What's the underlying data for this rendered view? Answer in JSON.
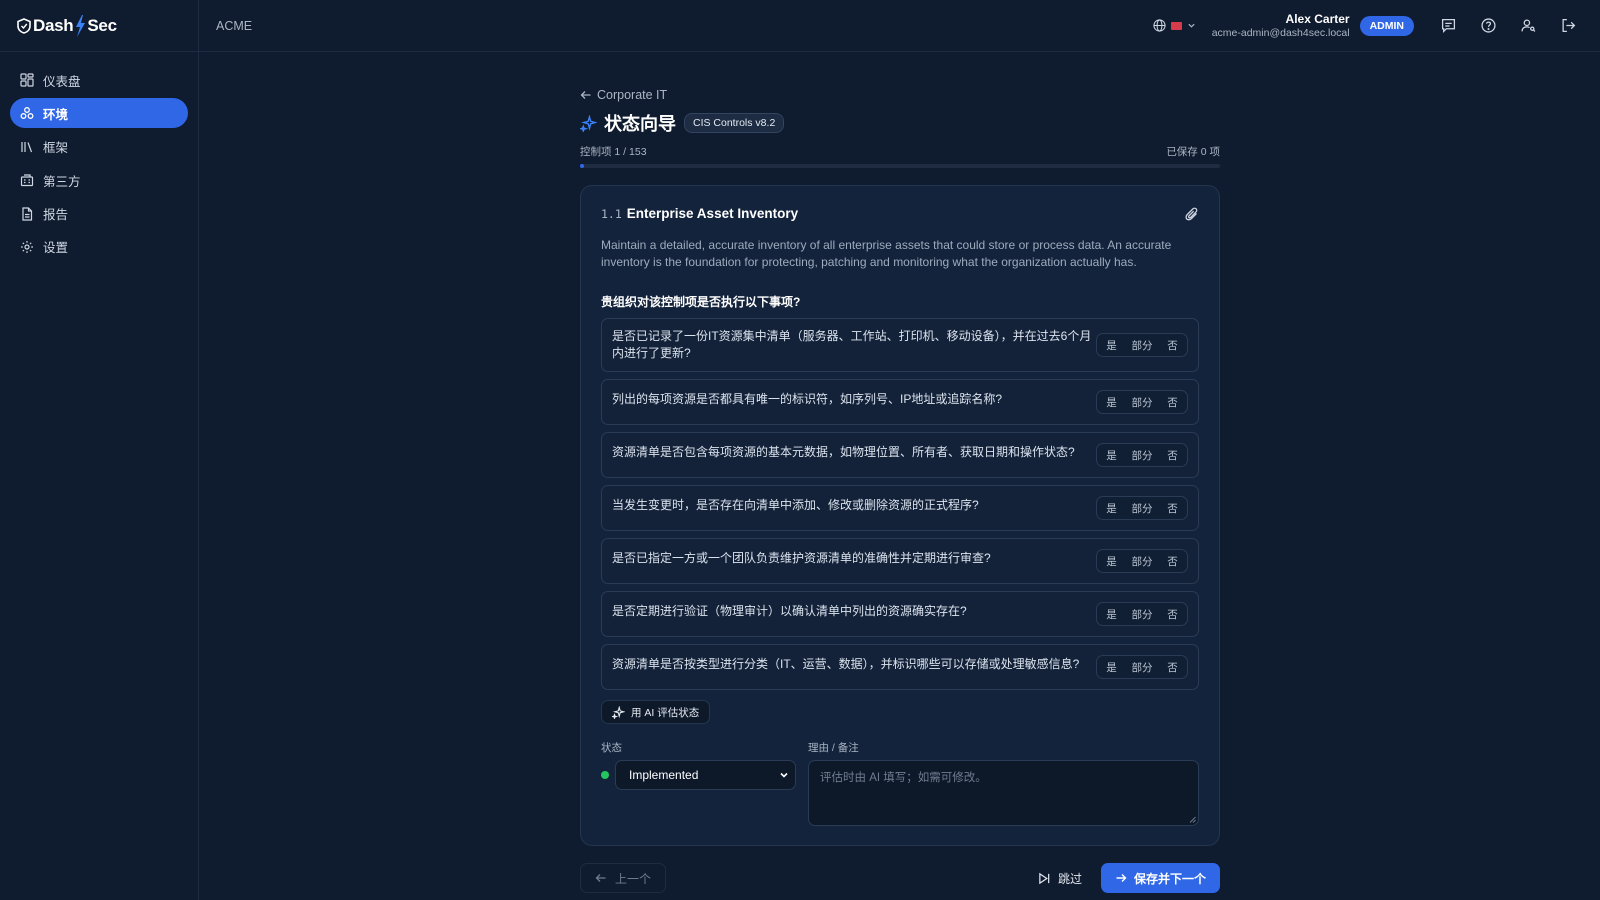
{
  "brand": {
    "name_left": "Dash",
    "name_right": "Sec"
  },
  "sidebar": {
    "items": [
      {
        "label": "仪表盘",
        "icon": "dashboard-icon",
        "active": false
      },
      {
        "label": "环境",
        "icon": "environment-icon",
        "active": true
      },
      {
        "label": "框架",
        "icon": "library-icon",
        "active": false
      },
      {
        "label": "第三方",
        "icon": "building-icon",
        "active": false
      },
      {
        "label": "报告",
        "icon": "document-icon",
        "active": false
      },
      {
        "label": "设置",
        "icon": "gear-icon",
        "active": false
      }
    ]
  },
  "header": {
    "org": "ACME",
    "user_name": "Alex Carter",
    "user_email": "acme-admin@dash4sec.local",
    "role_badge": "ADMIN"
  },
  "wizard": {
    "back_label": "Corporate IT",
    "title": "状态向导",
    "framework_badge": "CIS Controls v8.2",
    "progress_label": "控制项 1 / 153",
    "saved_label": "已保存 0 项",
    "progress_fraction": 0.0065
  },
  "control": {
    "id": "1.1",
    "name": "Enterprise Asset Inventory",
    "description": "Maintain a detailed, accurate inventory of all enterprise assets that could store or process data. An accurate inventory is the foundation for protecting, patching and monitoring what the organization actually has.",
    "question_heading": "贵组织对该控制项是否执行以下事项?",
    "answer_options": {
      "yes": "是",
      "partial": "部分",
      "no": "否"
    },
    "questions": [
      "是否已记录了一份IT资源集中清单（服务器、工作站、打印机、移动设备），并在过去6个月内进行了更新?",
      "列出的每项资源是否都具有唯一的标识符，如序列号、IP地址或追踪名称?",
      "资源清单是否包含每项资源的基本元数据，如物理位置、所有者、获取日期和操作状态?",
      "当发生变更时，是否存在向清单中添加、修改或删除资源的正式程序?",
      "是否已指定一方或一个团队负责维护资源清单的准确性并定期进行审查?",
      "是否定期进行验证（物理审计）以确认清单中列出的资源确实存在?",
      "资源清单是否按类型进行分类（IT、运营、数据），并标识哪些可以存储或处理敏感信息?"
    ],
    "ai_button": "用 AI 评估状态",
    "status_label": "状态",
    "status_value": "Implemented",
    "status_color": "#22c55e",
    "notes_label": "理由 / 备注",
    "notes_placeholder": "评估时由 AI 填写；如需可修改。"
  },
  "footer": {
    "prev_label": "上一个",
    "skip_label": "跳过",
    "next_label": "保存并下一个"
  },
  "colors": {
    "accent": "#2f67e6",
    "background": "#0f1b2e",
    "card": "#13233b"
  }
}
